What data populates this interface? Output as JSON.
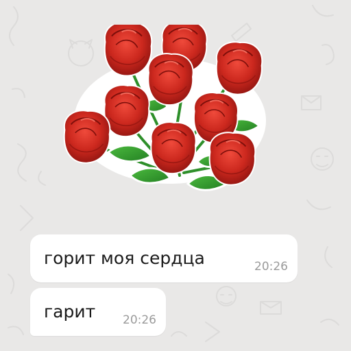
{
  "chat": {
    "background_color": "#e9e8e7",
    "sticker": {
      "icon": "red-roses-sticker",
      "rose_color": "#c8261d",
      "leaf_color": "#2f9a2c"
    },
    "messages": [
      {
        "text": "горит моя сердца",
        "time": "20:26"
      },
      {
        "text": "гарит",
        "time": "20:26"
      }
    ]
  }
}
